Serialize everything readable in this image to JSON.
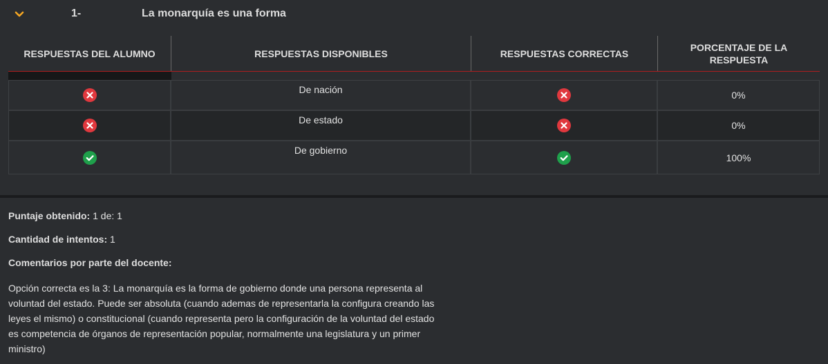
{
  "question": {
    "number": "1-",
    "title": "La monarquía es una forma",
    "accent_color": "#f5a623"
  },
  "table": {
    "headers": {
      "student": "RESPUESTAS DEL ALUMNO",
      "available": "RESPUESTAS DISPONIBLES",
      "correct": "RESPUESTAS CORRECTAS",
      "percent": "PORCENTAJE DE LA RESPUESTA"
    },
    "rows": [
      {
        "student_icon": "x-circle-icon",
        "option": "De nación",
        "correct_icon": "x-circle-icon",
        "percent": "0%"
      },
      {
        "student_icon": "x-circle-icon",
        "option": "De estado",
        "correct_icon": "x-circle-icon",
        "percent": "0%"
      },
      {
        "student_icon": "check-circle-icon",
        "option": "De gobierno",
        "correct_icon": "check-circle-icon",
        "percent": "100%"
      }
    ],
    "header_rule_color": "#b01e1e",
    "wrong_color": "#e0383e",
    "right_color": "#1fa04b"
  },
  "summary": {
    "score_label": "Puntaje obtenido:",
    "score_value": "1 de: 1",
    "attempts_label": "Cantidad de intentos:",
    "attempts_value": "1",
    "comments_label": "Comentarios por parte del docente:",
    "comment": "Opción correcta es la 3: La monarquía es la forma de gobierno donde una persona representa al voluntad del estado. Puede ser absoluta (cuando ademas de representarla la configura creando las leyes el mismo) o constitucional (cuando representa pero la configuración de la voluntad del estado es competencia de órganos de representación popular, normalmente una legislatura y un primer ministro)"
  }
}
